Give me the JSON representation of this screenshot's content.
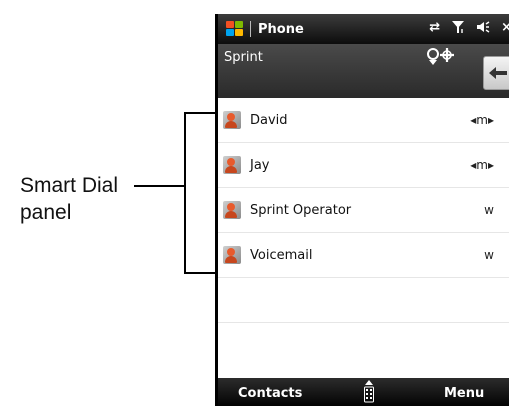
{
  "callout": {
    "line1": "Smart Dial",
    "line2": "panel"
  },
  "titlebar": {
    "title": "Phone",
    "icons": [
      "sync-icon",
      "signal-icon",
      "speaker-icon",
      "close-icon"
    ],
    "close_glyph": "×"
  },
  "carrier": {
    "name": "Sprint",
    "icon": "roaming-network-icon",
    "back_icon": "backspace-arrow-icon"
  },
  "smart_dial": {
    "rows": [
      {
        "name": "David",
        "key": "◂m▸"
      },
      {
        "name": "Jay",
        "key": "◂m▸"
      },
      {
        "name": "Sprint Operator",
        "key": "w"
      },
      {
        "name": "Voicemail",
        "key": "w"
      }
    ]
  },
  "softkeys": {
    "left": "Contacts",
    "right": "Menu",
    "center_icon": "keypad-icon"
  },
  "colors": {
    "titlebar": "#0c0c0c",
    "carrier_bar": "#3a3a3a",
    "avatar_accent": "#e85a2c"
  }
}
